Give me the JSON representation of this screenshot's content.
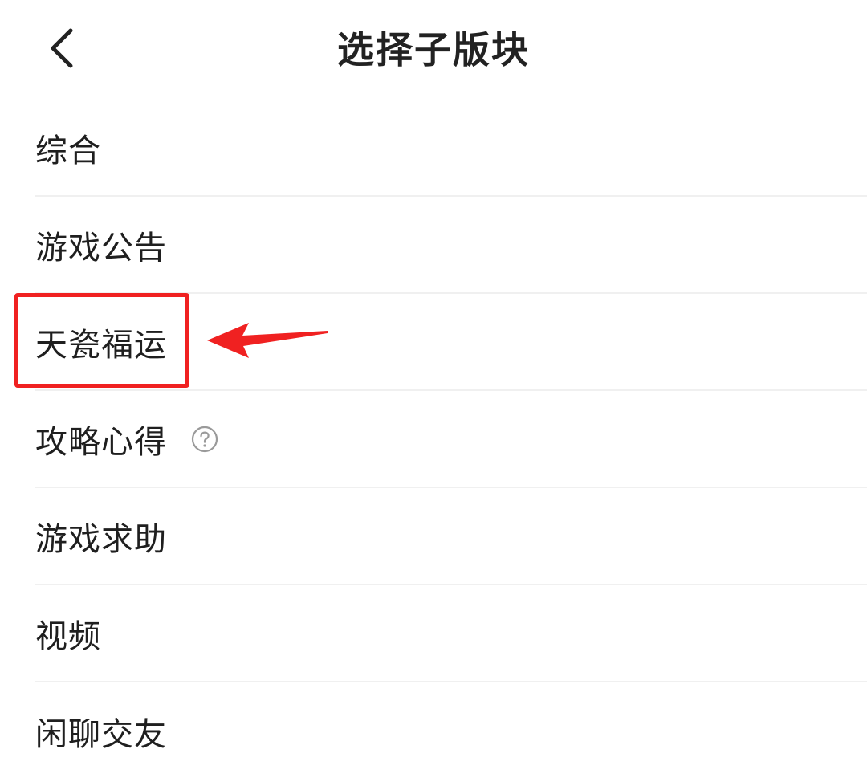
{
  "header": {
    "back_icon": "chevron-left-icon",
    "title": "选择子版块"
  },
  "sections": {
    "items": [
      {
        "label": "综合"
      },
      {
        "label": "游戏公告"
      },
      {
        "label": "天瓷福运"
      },
      {
        "label": "攻略心得",
        "help_icon": "question-circle-icon"
      },
      {
        "label": "游戏求助"
      },
      {
        "label": "视频"
      },
      {
        "label": "闲聊交友"
      }
    ]
  },
  "annotation": {
    "highlight_color": "#f02121",
    "highlighted_item": "天瓷福运",
    "arrow_icon": "arrow-left-icon"
  },
  "colors": {
    "divider": "#f0f0f0",
    "text": "#1f1f1f",
    "icon_gray": "#9a9a9a"
  }
}
